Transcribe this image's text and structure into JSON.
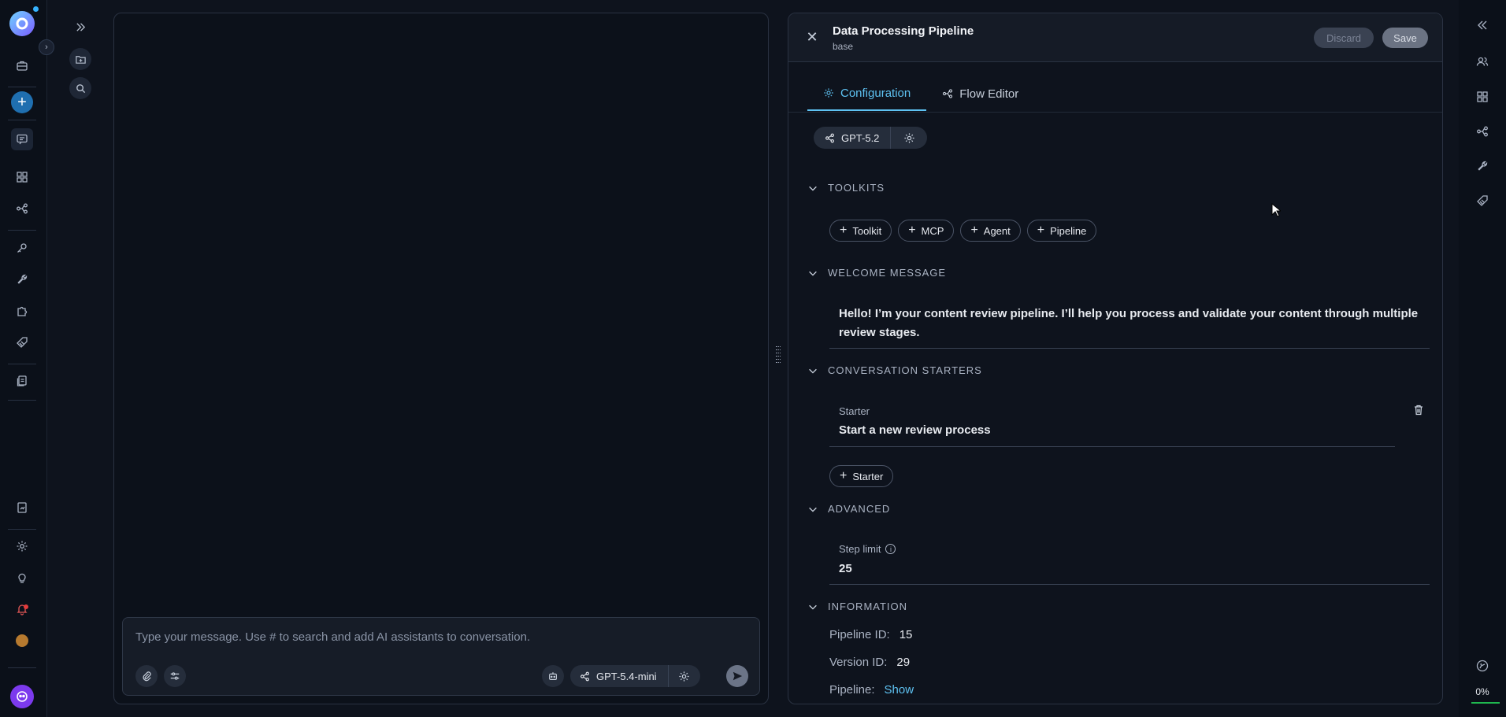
{
  "colors": {
    "accent": "#5ec2f2",
    "primary_button": "#1f6fb0",
    "bot_purple": "#7c3aed",
    "progress_green": "#1fb84f"
  },
  "chat": {
    "placeholder": "Type your message. Use # to search and add AI assistants to conversation.",
    "model": "GPT-5.4-mini"
  },
  "config": {
    "title": "Data Processing Pipeline",
    "subtitle": "base",
    "discard_label": "Discard",
    "save_label": "Save",
    "tabs": [
      {
        "label": "Configuration",
        "icon": "gear-icon"
      },
      {
        "label": "Flow Editor",
        "icon": "flow-icon"
      }
    ],
    "model": "GPT-5.2",
    "toolkits": {
      "heading": "TOOLKITS",
      "chips": [
        "Toolkit",
        "MCP",
        "Agent",
        "Pipeline"
      ]
    },
    "welcome": {
      "heading": "WELCOME MESSAGE",
      "text": "Hello! I’m your content review pipeline. I’ll help you process and validate your content through multiple review stages."
    },
    "starters": {
      "heading": "CONVERSATION STARTERS",
      "label": "Starter",
      "value": "Start a new review process",
      "add_label": "Starter"
    },
    "advanced": {
      "heading": "ADVANCED",
      "step_limit_label": "Step limit",
      "step_limit_value": "25"
    },
    "information": {
      "heading": "INFORMATION",
      "pipeline_id_label": "Pipeline ID:",
      "pipeline_id": "15",
      "version_id_label": "Version ID:",
      "version_id": "29",
      "pipeline_label": "Pipeline:",
      "pipeline_link": "Show"
    }
  },
  "progress": {
    "label": "0%",
    "value": 0
  }
}
